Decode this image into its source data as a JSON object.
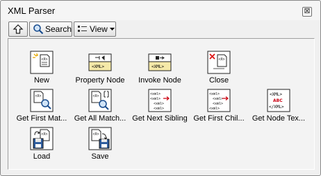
{
  "window": {
    "title": "XML Parser"
  },
  "toolbar": {
    "up_icon": "up-arrow-icon",
    "search_label": "Search",
    "view_label": "View",
    "search_icon": "magnifier-icon",
    "view_icon": "list-view-icon"
  },
  "palette": {
    "items": [
      {
        "label": "New",
        "icon": "new-xml-doc-icon"
      },
      {
        "label": "Property Node",
        "icon": "property-node-icon"
      },
      {
        "label": "Invoke Node",
        "icon": "invoke-node-icon"
      },
      {
        "label": "Close",
        "icon": "close-xml-icon"
      },
      {
        "label": "Get First Mat...",
        "icon": "get-first-match-icon"
      },
      {
        "label": "Get All Match...",
        "icon": "get-all-matches-icon"
      },
      {
        "label": "Get Next Sibling",
        "icon": "get-next-sibling-icon"
      },
      {
        "label": "Get First Chil...",
        "icon": "get-first-child-icon"
      },
      {
        "label": "Get Node Tex...",
        "icon": "get-node-text-icon"
      },
      {
        "label": "Load",
        "icon": "load-xml-icon"
      },
      {
        "label": "Save",
        "icon": "save-xml-icon"
      }
    ]
  }
}
